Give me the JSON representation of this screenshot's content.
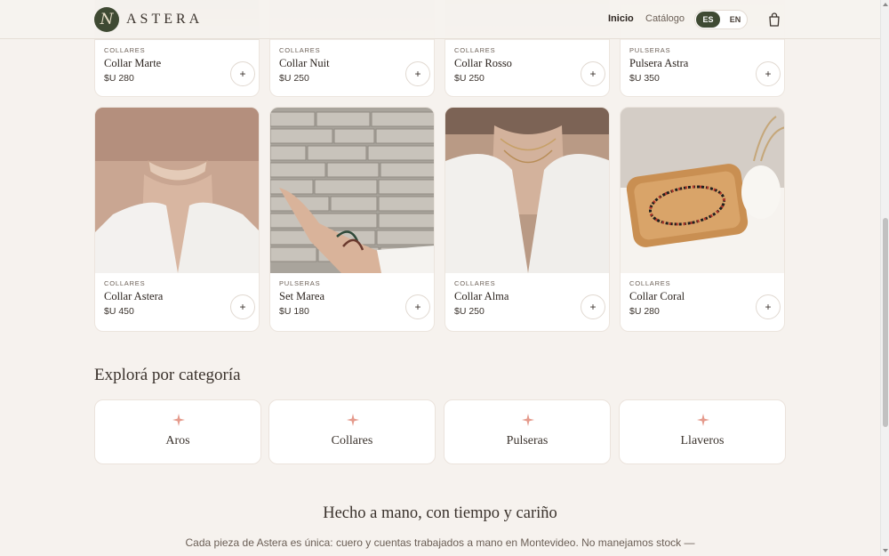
{
  "header": {
    "logo_letter": "N",
    "brand": "ASTERA",
    "nav": {
      "home": "Inicio",
      "catalog": "Catálogo"
    },
    "lang": {
      "es": "ES",
      "en": "EN",
      "active": "ES"
    },
    "cart_icon": "shopping-bag-icon"
  },
  "products_top": [
    {
      "category": "COLLARES",
      "name": "Collar Marte",
      "price": "$U 280"
    },
    {
      "category": "COLLARES",
      "name": "Collar Nuit",
      "price": "$U 250"
    },
    {
      "category": "COLLARES",
      "name": "Collar Rosso",
      "price": "$U 250"
    },
    {
      "category": "PULSERAS",
      "name": "Pulsera Astra",
      "price": "$U 350"
    }
  ],
  "products": [
    {
      "category": "COLLARES",
      "name": "Collar Astera",
      "price": "$U 450"
    },
    {
      "category": "PULSERAS",
      "name": "Set Marea",
      "price": "$U 180"
    },
    {
      "category": "COLLARES",
      "name": "Collar Alma",
      "price": "$U 250"
    },
    {
      "category": "COLLARES",
      "name": "Collar Coral",
      "price": "$U 280"
    }
  ],
  "add_symbol": "+",
  "categories_section": {
    "title": "Explorá por categoría",
    "items": [
      "Aros",
      "Collares",
      "Pulseras",
      "Llaveros"
    ],
    "icon": "sparkle-icon"
  },
  "handmade": {
    "title": "Hecho a mano, con tiempo y cariño",
    "text": "Cada pieza de Astera es única: cuero y cuentas trabajados a mano en Montevideo. No manejamos stock —"
  },
  "colors": {
    "accent": "#3f4a33",
    "background": "#f6f2ee",
    "sparkle": "#e59a8c"
  }
}
